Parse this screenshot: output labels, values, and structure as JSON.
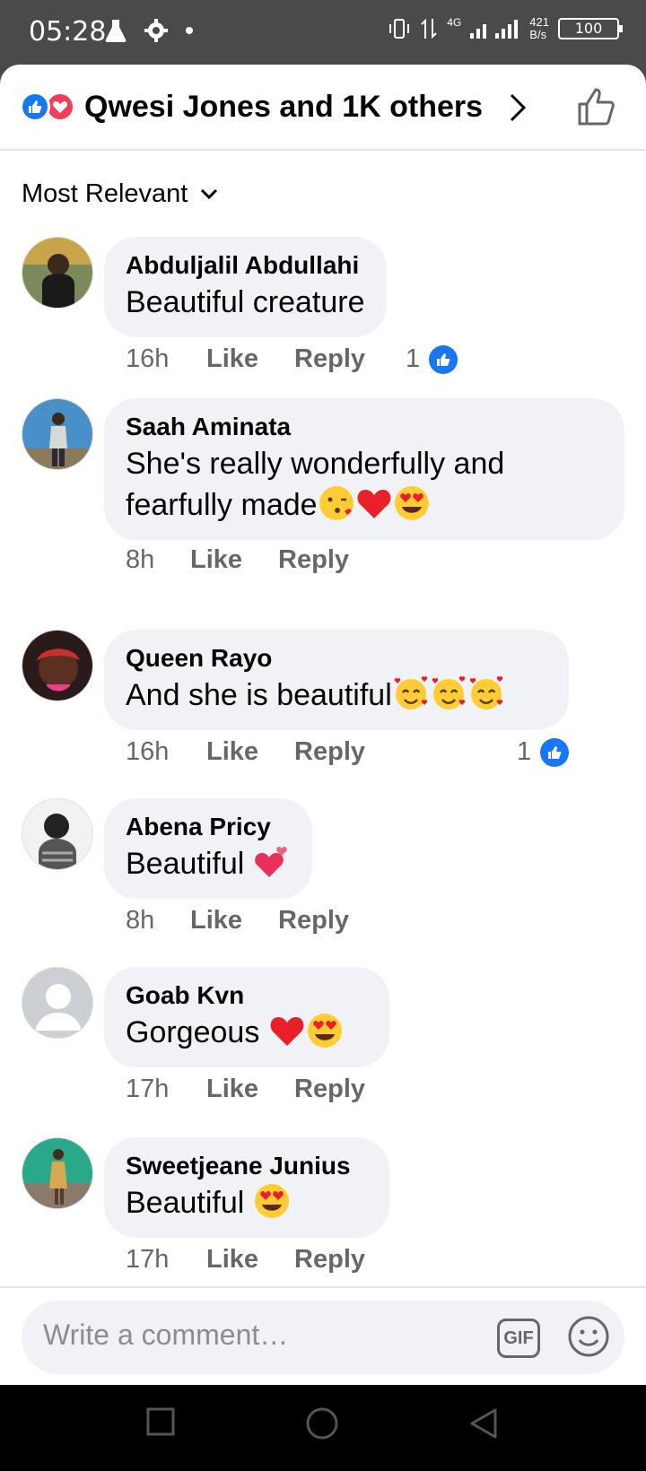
{
  "status_bar": {
    "time": "05:28",
    "network": "4G",
    "speed_value": "421",
    "speed_unit": "B/s",
    "battery": "100"
  },
  "header": {
    "title": "Qwesi Jones and 1K others",
    "reaction_icons": [
      "like-icon",
      "love-icon"
    ]
  },
  "sort": {
    "label": "Most Relevant"
  },
  "comments": [
    {
      "name": "Abduljalil Abdullahi",
      "text": "Beautiful creature",
      "time": "16h",
      "like": "Like",
      "reply": "Reply",
      "reactions": "1"
    },
    {
      "name": "Saah Aminata",
      "text1": "She's really wonderfully and",
      "text2": "fearfully made",
      "emojis": [
        "kissing-face",
        "red-heart",
        "heart-eyes"
      ],
      "time": "8h",
      "like": "Like",
      "reply": "Reply"
    },
    {
      "name": "Queen Rayo",
      "text": "And she is beautiful",
      "emojis": [
        "smiling-face-hearts",
        "smiling-face-hearts",
        "smiling-face-hearts"
      ],
      "time": "16h",
      "like": "Like",
      "reply": "Reply",
      "reactions": "1"
    },
    {
      "name": "Abena Pricy",
      "text": "Beautiful ",
      "emojis": [
        "two-hearts"
      ],
      "time": "8h",
      "like": "Like",
      "reply": "Reply"
    },
    {
      "name": "Goab Kvn",
      "text": "Gorgeous ",
      "emojis": [
        "red-heart",
        "heart-eyes"
      ],
      "time": "17h",
      "like": "Like",
      "reply": "Reply"
    },
    {
      "name": "Sweetjeane Junius",
      "text": "Beautiful ",
      "emojis": [
        "heart-eyes"
      ],
      "time": "17h",
      "like": "Like",
      "reply": "Reply"
    }
  ],
  "composer": {
    "placeholder": "Write a comment…",
    "gif_label": "GIF"
  },
  "colors": {
    "facebook_blue": "#1877f2",
    "love_red": "#f33e58",
    "bubble_bg": "#f0f2f5",
    "meta_gray": "#65676b"
  }
}
